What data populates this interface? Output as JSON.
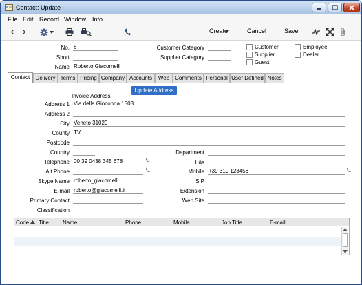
{
  "window": {
    "title": "Contact: Update"
  },
  "menubar": {
    "items": [
      "File",
      "Edit",
      "Record",
      "Window",
      "Info"
    ]
  },
  "toolbar": {
    "create_label": "Create",
    "cancel_label": "Cancel",
    "save_label": "Save"
  },
  "header": {
    "no_label": "No.",
    "no_value": "6",
    "short_label": "Short",
    "short_value": "",
    "name_label": "Name",
    "name_value": "Roberto Giacomelli",
    "customer_category_label": "Customer Category",
    "customer_category_value": "",
    "supplier_category_label": "Supplier Category",
    "supplier_category_value": "",
    "checks": {
      "customer": {
        "label": "Customer",
        "checked": false
      },
      "supplier": {
        "label": "Supplier",
        "checked": false
      },
      "guest": {
        "label": "Guest",
        "checked": false
      },
      "employee": {
        "label": "Employee",
        "checked": false
      },
      "dealer": {
        "label": "Dealer",
        "checked": false
      }
    }
  },
  "tabs": [
    "Contact",
    "Delivery",
    "Terms",
    "Pricing",
    "Company",
    "Accounts",
    "Web",
    "Comments",
    "Personal",
    "User Defined",
    "Notes"
  ],
  "active_tab": "Contact",
  "contact_tab": {
    "invoice_address_label": "Invoice Address",
    "update_address_button": "Update Address",
    "address1_label": "Address 1",
    "address1_value": "Via della Gioconda 1503",
    "address2_label": "Address 2",
    "address2_value": "",
    "city_label": "City",
    "city_value": "Veneto 31029",
    "county_label": "County",
    "county_value": "TV",
    "postcode_label": "Postcode",
    "postcode_value": "",
    "country_label": "Country",
    "country_value": "",
    "department_label": "Department",
    "department_value": "",
    "telephone_label": "Telephone",
    "telephone_value": "00 39 0438 345 678",
    "fax_label": "Fax",
    "fax_value": "",
    "alt_phone_label": "Alt Phone",
    "alt_phone_value": "",
    "mobile_label": "Mobile",
    "mobile_value": "+39 310 123456",
    "skype_label": "Skype Name",
    "skype_value": "roberto_giacomelli",
    "sip_label": "SIP",
    "sip_value": "",
    "email_label": "E-mail",
    "email_value": "roberto@giacomelli.it",
    "extension_label": "Extension",
    "extension_value": "",
    "primary_contact_label": "Primary Contact",
    "primary_contact_value": "",
    "website_label": "Web Site",
    "website_value": "",
    "classification_label": "Classification",
    "classification_value": ""
  },
  "contacts_grid": {
    "columns": [
      "Code",
      "Title",
      "Name",
      "Phone",
      "Mobile",
      "Job Title",
      "E-mail"
    ],
    "sort_column": "Code"
  },
  "colors": {
    "titlebar": "#b8cfea",
    "accent_button": "#2f6fc5",
    "close_button": "#c8462a"
  }
}
